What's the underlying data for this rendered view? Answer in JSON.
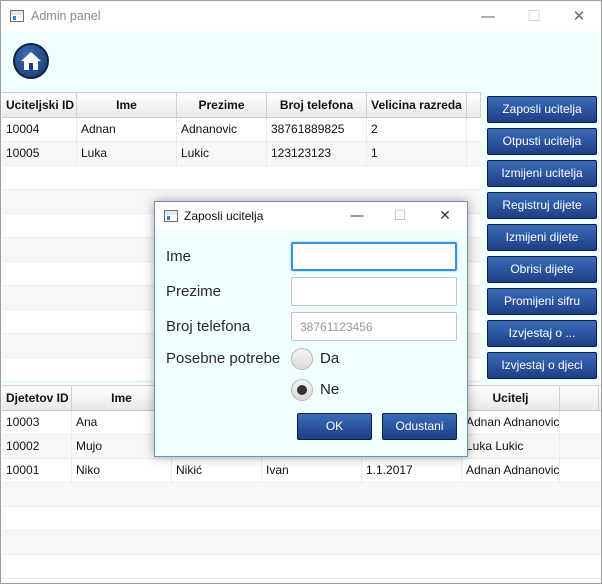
{
  "window": {
    "title": "Admin panel",
    "minimize_glyph": "—",
    "maximize_glyph": "☐",
    "close_glyph": "✕"
  },
  "icons": {
    "home": "home-icon",
    "app": "app-window-icon"
  },
  "colors": {
    "button_blue": "#2a55a0",
    "background": "#f0ffff",
    "focus_border": "#3d8fd8"
  },
  "teachers_table": {
    "columns": [
      "Uciteljski ID",
      "Ime",
      "Prezime",
      "Broj telefona",
      "Velicina razreda"
    ],
    "rows": [
      [
        "10004",
        "Adnan",
        "Adnanovic",
        "38761889825",
        "2"
      ],
      [
        "10005",
        "Luka",
        "Lukic",
        "123123123",
        "1"
      ]
    ]
  },
  "side_buttons": [
    "Zaposli ucitelja",
    "Otpusti ucitelja",
    "Izmijeni ucitelja",
    "Registruj dijete",
    "Izmijeni dijete",
    "Obrisi dijete",
    "Promijeni sifru",
    "Izvjestaj o ...",
    "Izvjestaj o djeci"
  ],
  "children_table": {
    "columns": [
      "Djetetov ID",
      "Ime",
      "",
      "",
      "",
      "Ucitelj"
    ],
    "rows": [
      [
        "10003",
        "Ana",
        "",
        "",
        "",
        "Adnan Adnanovic"
      ],
      [
        "10002",
        "Mujo",
        "",
        "",
        "",
        "Luka Lukic"
      ],
      [
        "10001",
        "Niko",
        "Nikić",
        "Ivan",
        "1.1.2017",
        "Adnan Adnanovic"
      ]
    ]
  },
  "dialog": {
    "title": "Zaposli ucitelja",
    "fields": {
      "ime_label": "Ime",
      "ime_value": "",
      "prezime_label": "Prezime",
      "prezime_value": "",
      "telefon_label": "Broj telefona",
      "telefon_placeholder": "38761123456",
      "potrebe_label": "Posebne potrebe"
    },
    "radio": {
      "da_label": "Da",
      "ne_label": "Ne",
      "selected": "Ne"
    },
    "ok_label": "OK",
    "cancel_label": "Odustani"
  }
}
